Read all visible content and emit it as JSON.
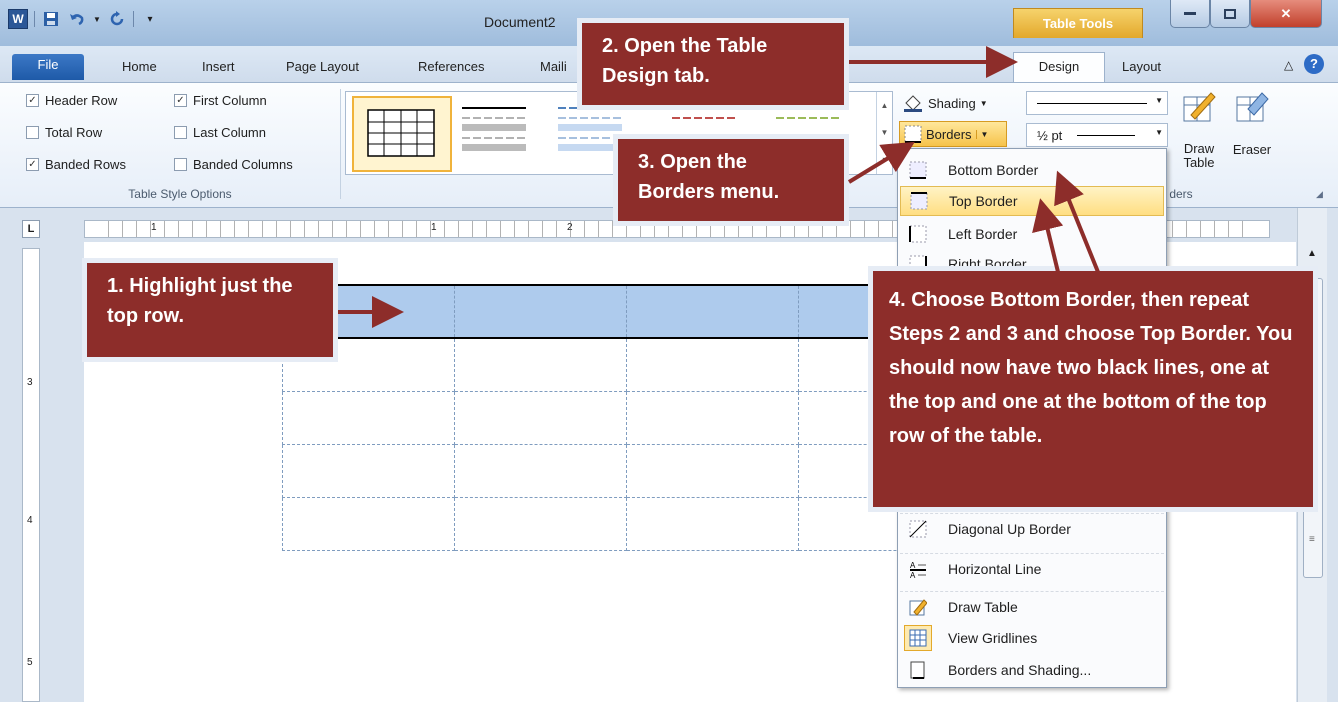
{
  "window": {
    "doc_title": "Document2",
    "contextual_tab": "Table Tools"
  },
  "tabs": [
    "File",
    "Home",
    "Insert",
    "Page Layout",
    "References",
    "Maili",
    "Design",
    "Layout"
  ],
  "ribbon": {
    "style_options": {
      "header_row": "Header Row",
      "first_column": "First Column",
      "total_row": "Total Row",
      "last_column": "Last Column",
      "banded_rows": "Banded Rows",
      "banded_columns": "Banded Columns",
      "group_label": "Table Style Options"
    },
    "shading": "Shading",
    "borders": "Borders",
    "pen_weight": "½ pt",
    "draw_table": "Draw\nTable",
    "eraser": "Eraser",
    "borders_group_label": "ders"
  },
  "borders_menu": [
    {
      "label": "Bottom Border",
      "icon": "bottom-border-icon"
    },
    {
      "label": "Top Border",
      "icon": "top-border-icon"
    },
    {
      "label": "Left Border",
      "icon": "left-border-icon"
    },
    {
      "label": "Right Border",
      "icon": "right-border-icon"
    },
    {
      "label": "Diagonal Up Border",
      "icon": "diagonal-up-border-icon"
    },
    {
      "label": "Horizontal Line",
      "icon": "horizontal-line-icon"
    },
    {
      "label": "Draw Table",
      "icon": "draw-table-icon"
    },
    {
      "label": "View Gridlines",
      "icon": "view-gridlines-icon"
    },
    {
      "label": "Borders and Shading...",
      "icon": "borders-and-shading-icon"
    }
  ],
  "callouts": {
    "step1": "1. Highlight just the top row.",
    "step2": "2. Open the Table Design tab.",
    "step3": "3. Open the Borders menu.",
    "step4": "4. Choose Bottom Border, then repeat Steps 2 and 3 and choose Top Border. You should now have two black lines, one at the top and one at the bottom of the top row of the table."
  },
  "colors": {
    "callout_bg": "#8d2d2a",
    "selection": "#aecbed",
    "highlight": "#ffde82"
  }
}
